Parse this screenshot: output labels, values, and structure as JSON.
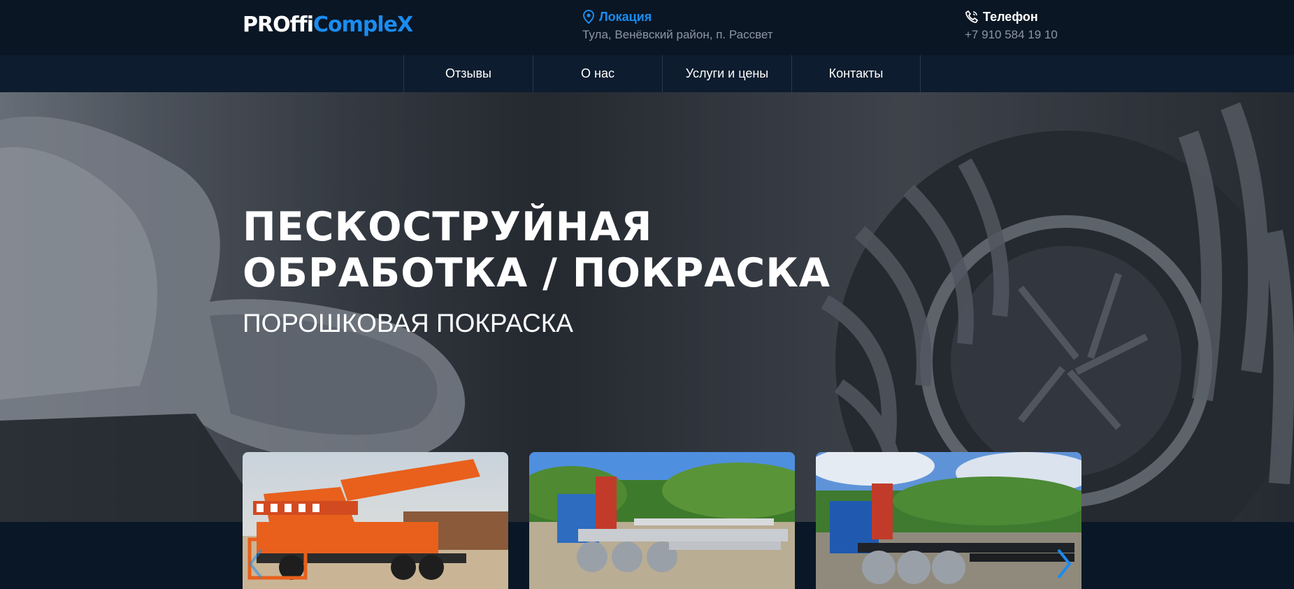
{
  "logo": {
    "part1": "PROffi",
    "part2": "CompleX"
  },
  "location": {
    "label": "Локация",
    "value": "Тула, Венёвский район, п. Рассвет",
    "icon": "map-pin-icon"
  },
  "phone": {
    "label": "Телефон",
    "value": "+7 910 584 19 10",
    "icon": "phone-icon"
  },
  "nav": {
    "items": [
      {
        "label": "Отзывы"
      },
      {
        "label": "О нас"
      },
      {
        "label": "Услуги и цены"
      },
      {
        "label": "Контакты"
      }
    ]
  },
  "hero": {
    "title_line1": "ПЕСКОСТРУЙНАЯ",
    "title_line2": "ОБРАБОТКА / ПОКРАСКА",
    "subtitle": "ПОРОШКОВАЯ ПОКРАСКА"
  },
  "gallery": {
    "cards": [
      {
        "name": "orange-crane-truck"
      },
      {
        "name": "crane-truck-frame"
      },
      {
        "name": "crane-truck-chassis"
      }
    ],
    "prev_icon": "chevron-left-icon",
    "next_icon": "chevron-right-icon"
  },
  "colors": {
    "accent": "#1a8cf0",
    "header_bg": "#0a1624",
    "nav_bg": "#0d1c2e"
  }
}
